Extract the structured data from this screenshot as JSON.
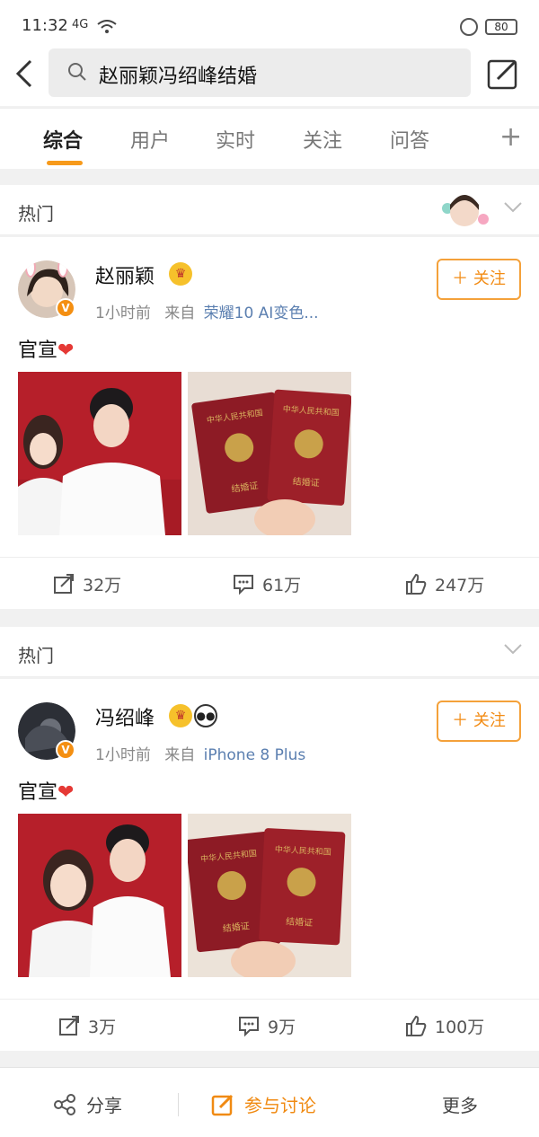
{
  "status": {
    "time": "11:32",
    "signal": "4G",
    "battery": "80"
  },
  "search": {
    "query": "赵丽颖冯绍峰结婚"
  },
  "tabs": [
    {
      "label": "综合",
      "active": true
    },
    {
      "label": "用户"
    },
    {
      "label": "实时"
    },
    {
      "label": "关注"
    },
    {
      "label": "问答"
    }
  ],
  "posts": [
    {
      "section": "热门",
      "username": "赵丽颖",
      "time": "1小时前",
      "from": "来自",
      "source": "荣耀10 AI变色...",
      "follow": "关注",
      "text": "官宣",
      "certificate_text": [
        "中华人民共和国",
        "结婚证"
      ],
      "actions": {
        "share": "32万",
        "comment": "61万",
        "like": "247万"
      }
    },
    {
      "section": "热门",
      "username": "冯绍峰",
      "time": "1小时前",
      "from": "来自",
      "source": "iPhone 8 Plus",
      "follow": "关注",
      "text": "官宣",
      "certificate_text": [
        "中华人民共和国",
        "结婚证"
      ],
      "actions": {
        "share": "3万",
        "comment": "9万",
        "like": "100万"
      }
    }
  ],
  "bottom": {
    "share": "分享",
    "discuss": "参与讨论",
    "more": "更多"
  },
  "colors": {
    "accent": "#f79a1b",
    "link": "#5b7fb0",
    "heart": "#e53935"
  },
  "icons": [
    "back-arrow-icon",
    "search-icon",
    "compose-icon",
    "chevron-down-icon",
    "share-icon",
    "comment-icon",
    "like-icon",
    "vip-crown-icon",
    "verified-badge-icon"
  ]
}
